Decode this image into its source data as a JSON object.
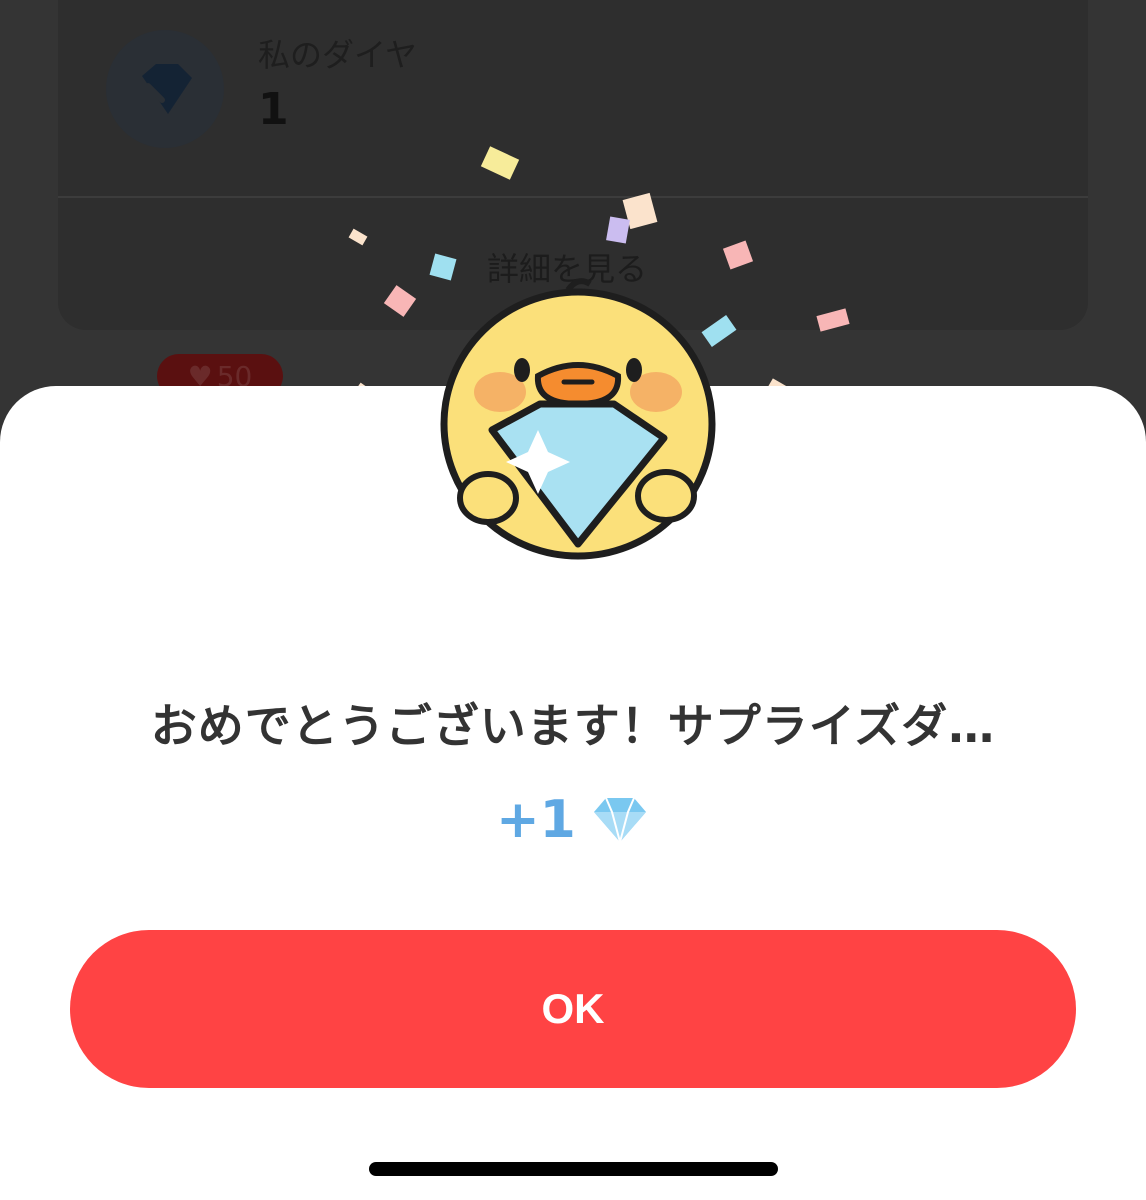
{
  "background": {
    "my_diamonds_label": "私のダイヤ",
    "my_diamonds_count": "1",
    "view_details": "詳細を見る",
    "like_count": "50"
  },
  "dialog": {
    "title": "おめでとうございます！サプライズダ…",
    "reward_amount": "+1",
    "reward_icon": "diamond-icon",
    "ok_label": "OK"
  },
  "colors": {
    "accent": "#ff4344",
    "reward_blue": "#5fa8e3",
    "overlay": "#343434"
  }
}
